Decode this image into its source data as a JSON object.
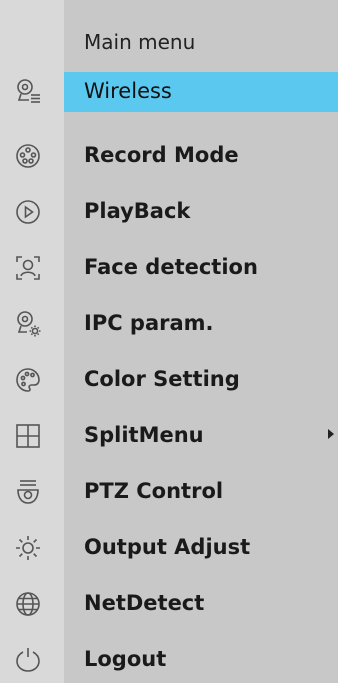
{
  "menu": {
    "title": "Main menu",
    "items": [
      {
        "label": "Wireless",
        "icon": "camera-list-icon",
        "selected": true
      },
      {
        "label": "Record Mode",
        "icon": "film-reel-icon"
      },
      {
        "label": "PlayBack",
        "icon": "play-circle-icon"
      },
      {
        "label": "Face detection",
        "icon": "face-detection-icon"
      },
      {
        "label": "IPC param.",
        "icon": "camera-settings-icon"
      },
      {
        "label": "Color Setting",
        "icon": "palette-icon"
      },
      {
        "label": "SplitMenu",
        "icon": "grid-split-icon",
        "has_submenu": true
      },
      {
        "label": "PTZ Control",
        "icon": "ptz-camera-icon"
      },
      {
        "label": "Output Adjust",
        "icon": "brightness-icon"
      },
      {
        "label": "NetDetect",
        "icon": "globe-icon"
      },
      {
        "label": "Logout",
        "icon": "power-icon"
      }
    ]
  },
  "colors": {
    "highlight": "#5bc8f0",
    "panel": "#c8c8c8",
    "icon_column": "#d9d9d9",
    "text": "#1a1a1a",
    "icon_stroke": "#555555"
  }
}
